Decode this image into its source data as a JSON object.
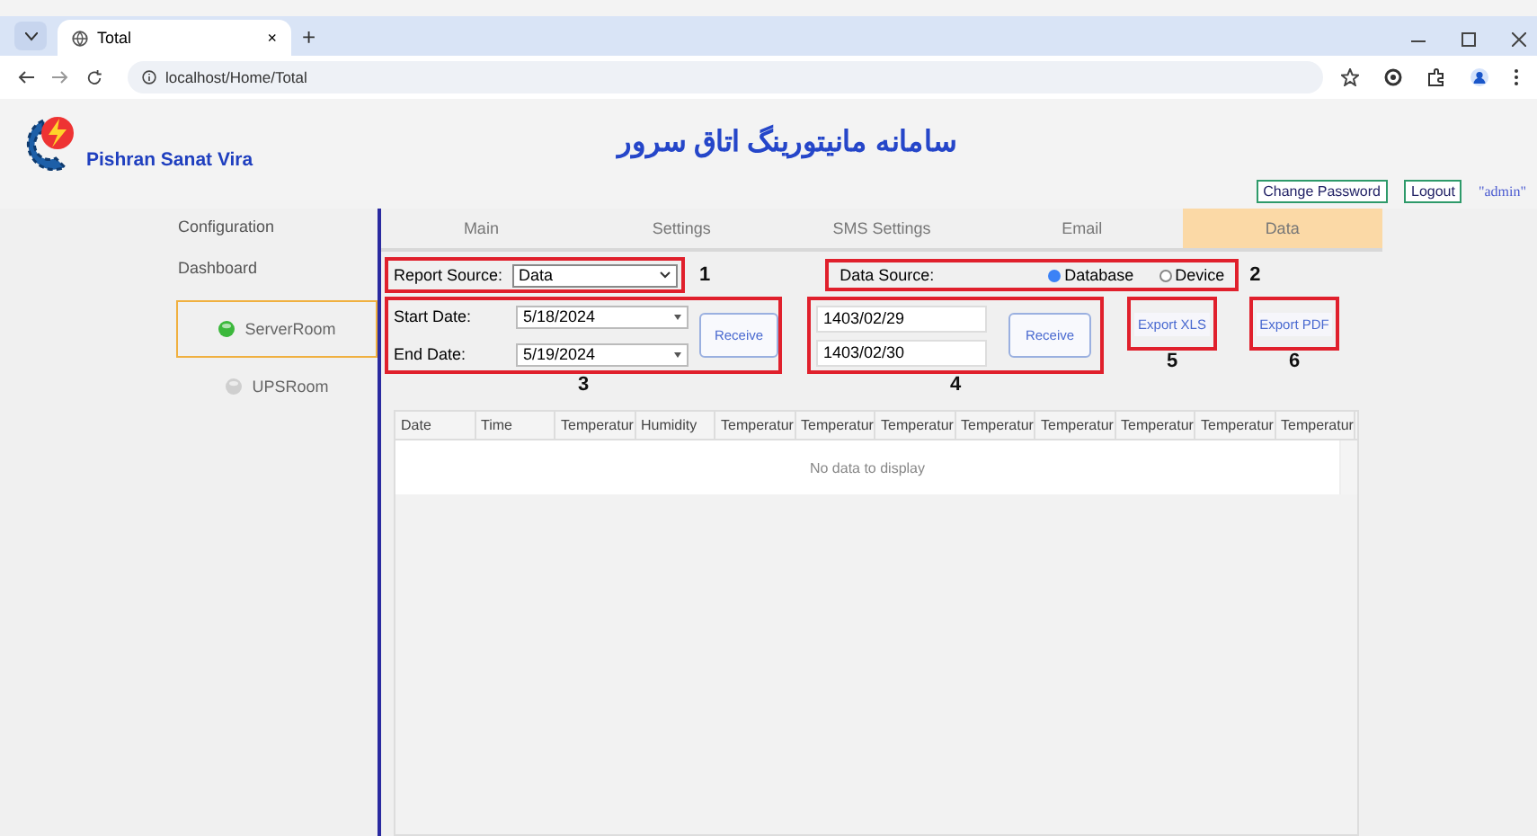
{
  "browser": {
    "tab_title": "Total",
    "tab_close": "×",
    "new_tab": "+",
    "url": "localhost/Home/Total"
  },
  "header": {
    "company": "Pishran Sanat Vira",
    "title": "سامانه مانیتورینگ اتاق سرور",
    "buttons": [
      "Change Password",
      "Logout"
    ],
    "user": "\"admin\""
  },
  "sidebar": {
    "items": [
      {
        "label": "Configuration"
      },
      {
        "label": "Dashboard"
      }
    ],
    "rooms": [
      {
        "label": "ServerRoom",
        "selected": true,
        "online": true
      },
      {
        "label": "UPSRoom",
        "selected": false,
        "online": false
      }
    ]
  },
  "tabs": [
    {
      "label": "Main",
      "selected": false
    },
    {
      "label": "Settings",
      "selected": false
    },
    {
      "label": "SMS Settings",
      "selected": false
    },
    {
      "label": "Email",
      "selected": false
    },
    {
      "label": "Data",
      "selected": true
    }
  ],
  "report_source": {
    "label": "Report Source:",
    "value": "Data",
    "marker": "1"
  },
  "data_source": {
    "label": "Data Source:",
    "options": [
      {
        "label": "Database",
        "selected": true
      },
      {
        "label": "Device",
        "selected": false
      }
    ],
    "marker": "2"
  },
  "gregorian_range": {
    "start_label": "Start Date:",
    "start_value": "5/18/2024",
    "end_label": "End Date:",
    "end_value": "5/19/2024",
    "button": "Receive",
    "marker": "3"
  },
  "persian_range": {
    "start_value": "1403/02/29",
    "end_value": "1403/02/30",
    "button": "Receive",
    "marker": "4"
  },
  "exports": [
    {
      "label": "Export XLS",
      "marker": "5"
    },
    {
      "label": "Export PDF",
      "marker": "6"
    }
  ],
  "table": {
    "columns": [
      "Date",
      "Time",
      "Temperatur",
      "Humidity",
      "Temperatur",
      "Temperatur",
      "Temperatur",
      "Temperatur",
      "Temperatur",
      "Temperatur",
      "Temperatur",
      "Temperatur"
    ],
    "empty_text": "No data to display"
  }
}
